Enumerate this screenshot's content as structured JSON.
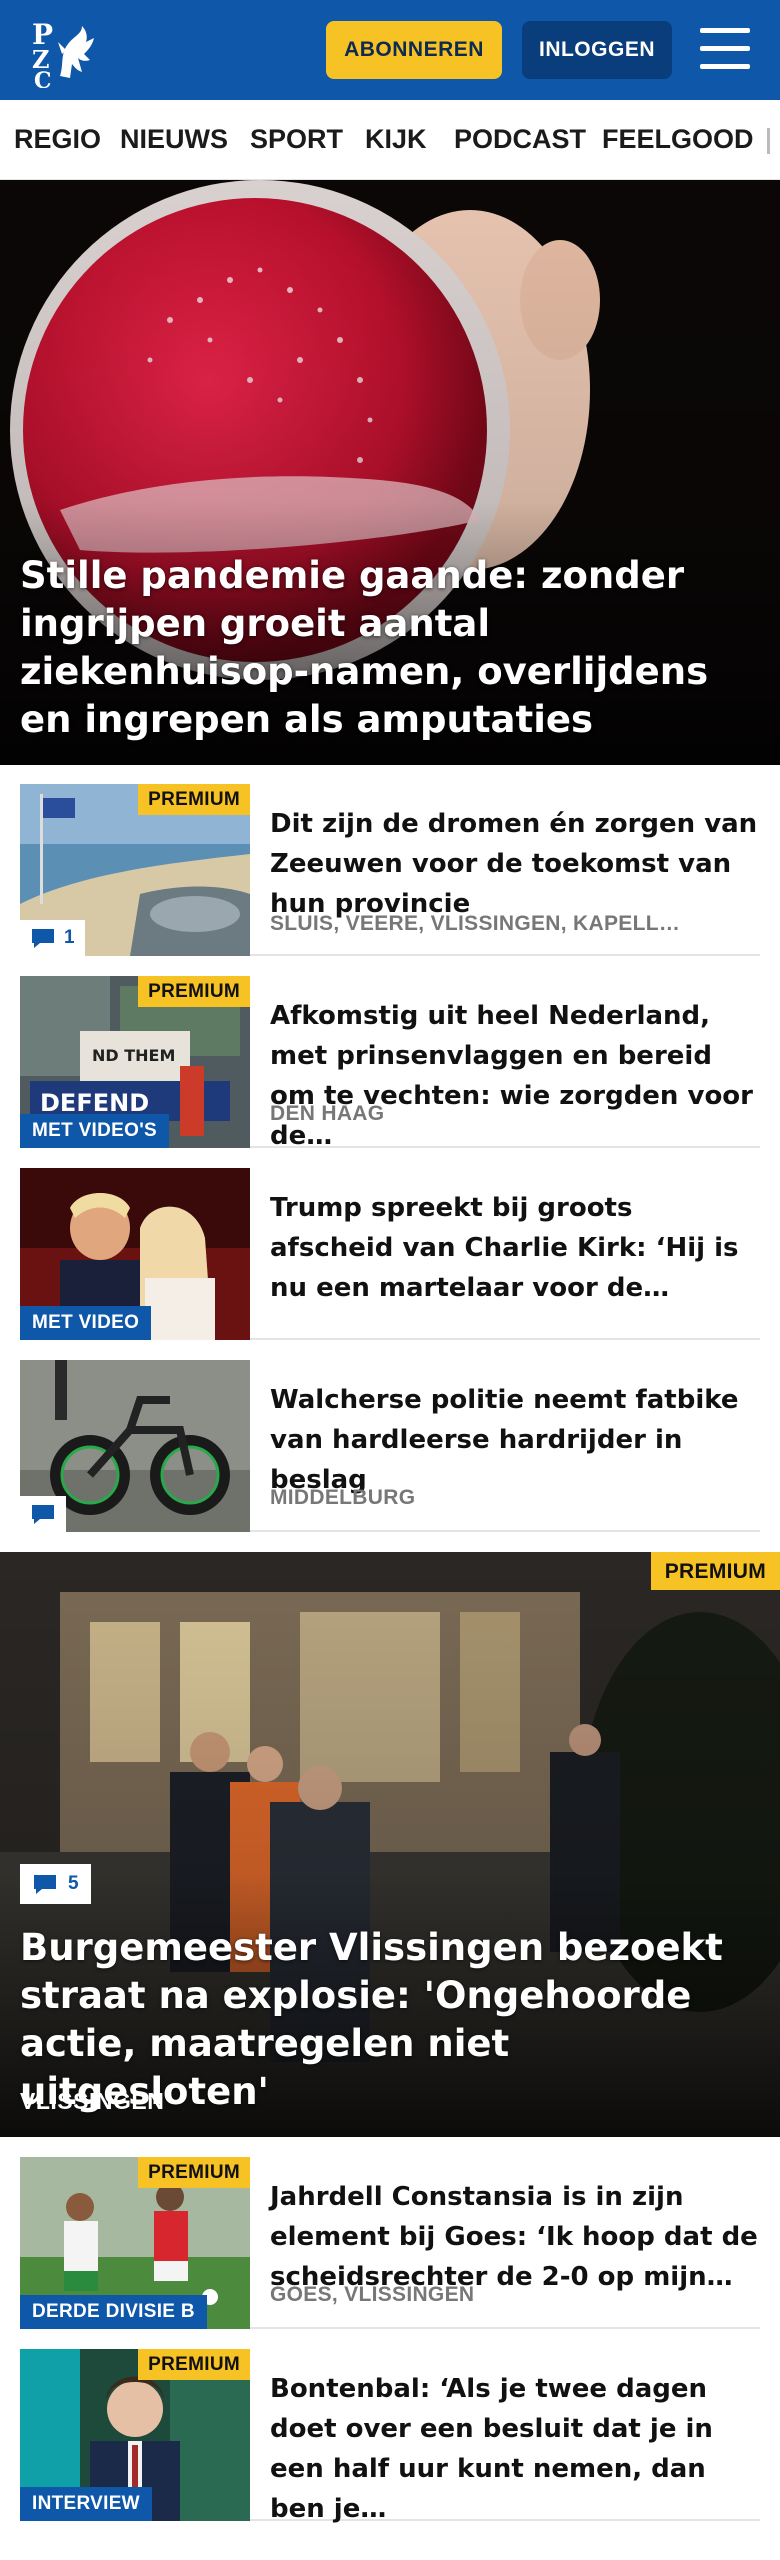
{
  "header": {
    "subscribe_label": "ABONNEREN",
    "login_label": "INLOGGEN",
    "logo_icon": "pzc-logo-icon",
    "menu_icon": "hamburger-menu-icon",
    "brand_color": "#0f57a8",
    "accent_color": "#f6c224"
  },
  "nav": {
    "items": [
      "REGIO",
      "NIEUWS",
      "SPORT",
      "KIJK",
      "PODCAST",
      "FEELGOOD"
    ]
  },
  "hero": {
    "title": "Stille pandemie gaande: zonder ingrijpen groeit aantal ziekenhuisop-namen, overlijdens en ingrepen als amputaties"
  },
  "articles": [
    {
      "title": "Dit zijn de dromen én zorgen van Zeeuwen voor de toekomst van hun provincie",
      "location": "SLUIS, VEERE, VLISSINGEN, KAPELL…",
      "badge": "PREMIUM",
      "comments": "1"
    },
    {
      "title": "Afkomstig uit heel Nederland, met prinsenvlaggen en bereid om te vechten: wie zorgden voor de…",
      "location": "DEN HAAG",
      "badge": "PREMIUM",
      "tag": "MET VIDEO'S"
    },
    {
      "title": "Trump spreekt bij groots afscheid van Charlie Kirk: ‘Hij is nu een martelaar voor de…",
      "tag": "MET VIDEO"
    },
    {
      "title": "Walcherse politie neemt fatbike van hardleerse hardrijder in beslag",
      "location": "MIDDELBURG"
    }
  ],
  "feature": {
    "badge": "PREMIUM",
    "comments": "5",
    "title": "Burgemeester Vlissingen bezoekt straat na explosie: 'Ongehoorde actie, maatregelen niet uitgesloten'",
    "location": "VLISSINGEN"
  },
  "articles2": [
    {
      "title": "Jahrdell Constansia is in zijn element bij Goes: ‘Ik hoop dat de scheidsrechter de 2-0 op mijn…",
      "location": "GOES, VLISSINGEN",
      "badge": "PREMIUM",
      "tag": "DERDE DIVISIE B"
    },
    {
      "title": "Bontenbal: ‘Als je twee dagen doet over een besluit dat je in een half uur kunt nemen, dan ben je…",
      "badge": "PREMIUM",
      "tag": "INTERVIEW"
    }
  ]
}
